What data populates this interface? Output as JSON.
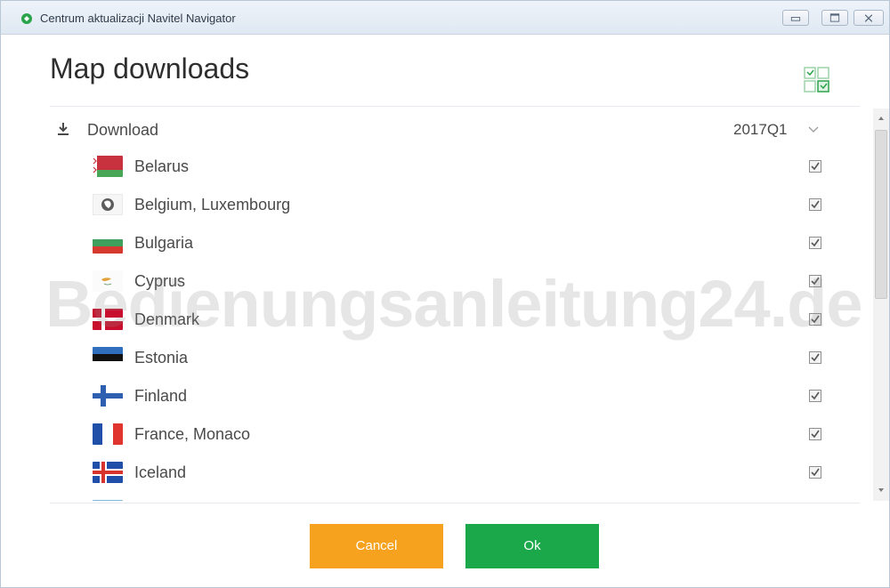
{
  "window": {
    "title": "Centrum aktualizacji Navitel Navigator"
  },
  "header": {
    "page_title": "Map downloads"
  },
  "download": {
    "label": "Download",
    "version": "2017Q1"
  },
  "countries": [
    {
      "name": "Belarus",
      "flag": "belarus-flag",
      "checked": true
    },
    {
      "name": "Belgium, Luxembourg",
      "flag": "globe-icon",
      "checked": true
    },
    {
      "name": "Bulgaria",
      "flag": "bulgaria-flag",
      "checked": true
    },
    {
      "name": "Cyprus",
      "flag": "cyprus-flag",
      "checked": true
    },
    {
      "name": "Denmark",
      "flag": "denmark-flag",
      "checked": true
    },
    {
      "name": "Estonia",
      "flag": "estonia-flag",
      "checked": true
    },
    {
      "name": "Finland",
      "flag": "finland-flag",
      "checked": true
    },
    {
      "name": "France, Monaco",
      "flag": "france-flag",
      "checked": true
    },
    {
      "name": "Iceland",
      "flag": "iceland-flag",
      "checked": true
    }
  ],
  "watermark": "Bedienungsanleitung24.de",
  "buttons": {
    "cancel": "Cancel",
    "ok": "Ok"
  },
  "colors": {
    "cancel": "#f6a21e",
    "ok": "#1aa84a"
  }
}
